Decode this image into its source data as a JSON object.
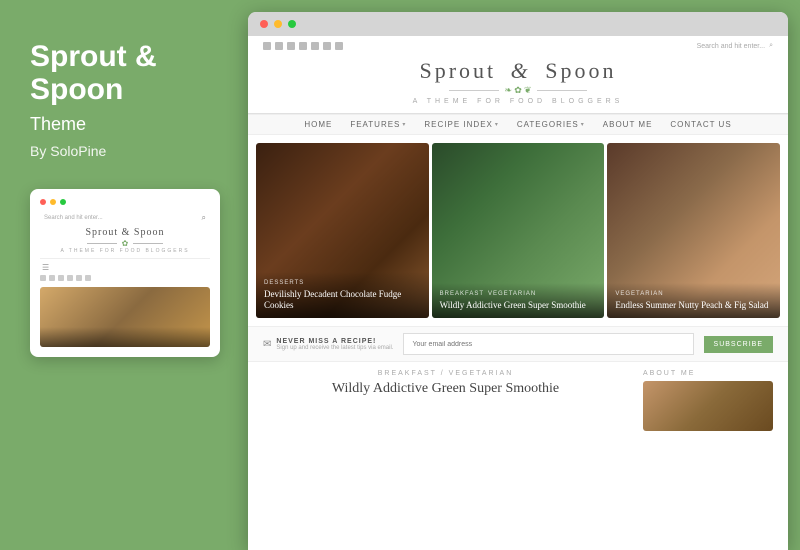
{
  "left_panel": {
    "title": "Sprout &",
    "title_line2": "Spoon",
    "subtitle": "Theme",
    "by": "By SoloPine"
  },
  "mobile_preview": {
    "search_placeholder": "Search and hit enter...",
    "logo_text": "Sprout & Spoon",
    "logo_tagline": "A THEME FOR FOOD BLOGGERS"
  },
  "browser": {
    "dots": [
      "red",
      "yellow",
      "green"
    ]
  },
  "website": {
    "social_icons_count": 7,
    "search_placeholder": "Search and hit enter...",
    "logo_text_1": "Sprout",
    "logo_ampersand": "&",
    "logo_text_2": "Spoon",
    "logo_tagline": "A THEME FOR FOOD BLOGGERS",
    "nav_items": [
      {
        "label": "HOME",
        "has_arrow": false
      },
      {
        "label": "FEATURES",
        "has_arrow": true
      },
      {
        "label": "RECIPE INDEX",
        "has_arrow": true
      },
      {
        "label": "CATEGORIES",
        "has_arrow": true
      },
      {
        "label": "ABOUT ME",
        "has_arrow": false
      },
      {
        "label": "CONTACT US",
        "has_arrow": false
      }
    ],
    "featured_cards": [
      {
        "tags": [
          "DESSERTS"
        ],
        "title": "Devilishly Decadent Chocolate Fudge Cookies"
      },
      {
        "tags": [
          "BREAKFAST",
          "VEGETARIAN"
        ],
        "title": "Wildly Addictive Green Super Smoothie"
      },
      {
        "tags": [
          "VEGETARIAN"
        ],
        "title": "Endless Summer Nutty Peach & Fig Salad"
      }
    ],
    "subscribe": {
      "title": "NEVER MISS A RECIPE!",
      "description": "Sign up and receive the latest tips via email.",
      "email_placeholder": "Your email address",
      "button_label": "SUBSCRIBE"
    },
    "post": {
      "category": "BREAKFAST / VEGETARIAN",
      "title": "Wildly Addictive Green Super Smoothie"
    },
    "sidebar": {
      "about_label": "ABOUT ME"
    }
  }
}
